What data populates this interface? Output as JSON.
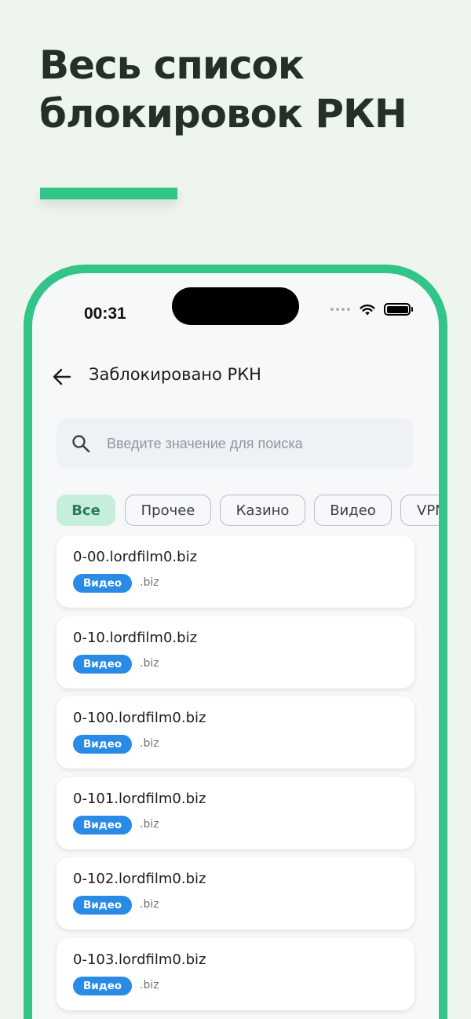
{
  "promo": {
    "title_line1": "Весь список",
    "title_line2": "блокировок РКН",
    "accent_color": "#33c488"
  },
  "status_bar": {
    "time": "00:31",
    "icons": [
      "signal-dots-icon",
      "wifi-icon",
      "battery-icon"
    ]
  },
  "appbar": {
    "back_icon": "arrow-left-icon",
    "title": "Заблокировано РКН"
  },
  "search": {
    "icon": "search-icon",
    "value": "",
    "placeholder": "Введите значение для поиска"
  },
  "filters": [
    {
      "label": "Все",
      "selected": true
    },
    {
      "label": "Прочее",
      "selected": false
    },
    {
      "label": "Казино",
      "selected": false
    },
    {
      "label": "Видео",
      "selected": false
    },
    {
      "label": "VPN",
      "selected": false
    }
  ],
  "items": [
    {
      "domain": "0-00.lordfilm0.biz",
      "category": "Видео",
      "tld": ".biz"
    },
    {
      "domain": "0-10.lordfilm0.biz",
      "category": "Видео",
      "tld": ".biz"
    },
    {
      "domain": "0-100.lordfilm0.biz",
      "category": "Видео",
      "tld": ".biz"
    },
    {
      "domain": "0-101.lordfilm0.biz",
      "category": "Видео",
      "tld": ".biz"
    },
    {
      "domain": "0-102.lordfilm0.biz",
      "category": "Видео",
      "tld": ".biz"
    },
    {
      "domain": "0-103.lordfilm0.biz",
      "category": "Видео",
      "tld": ".biz"
    }
  ],
  "colors": {
    "background": "#eef5ee",
    "badge": "#2a8be6",
    "chip_selected": "#c5eedb"
  }
}
